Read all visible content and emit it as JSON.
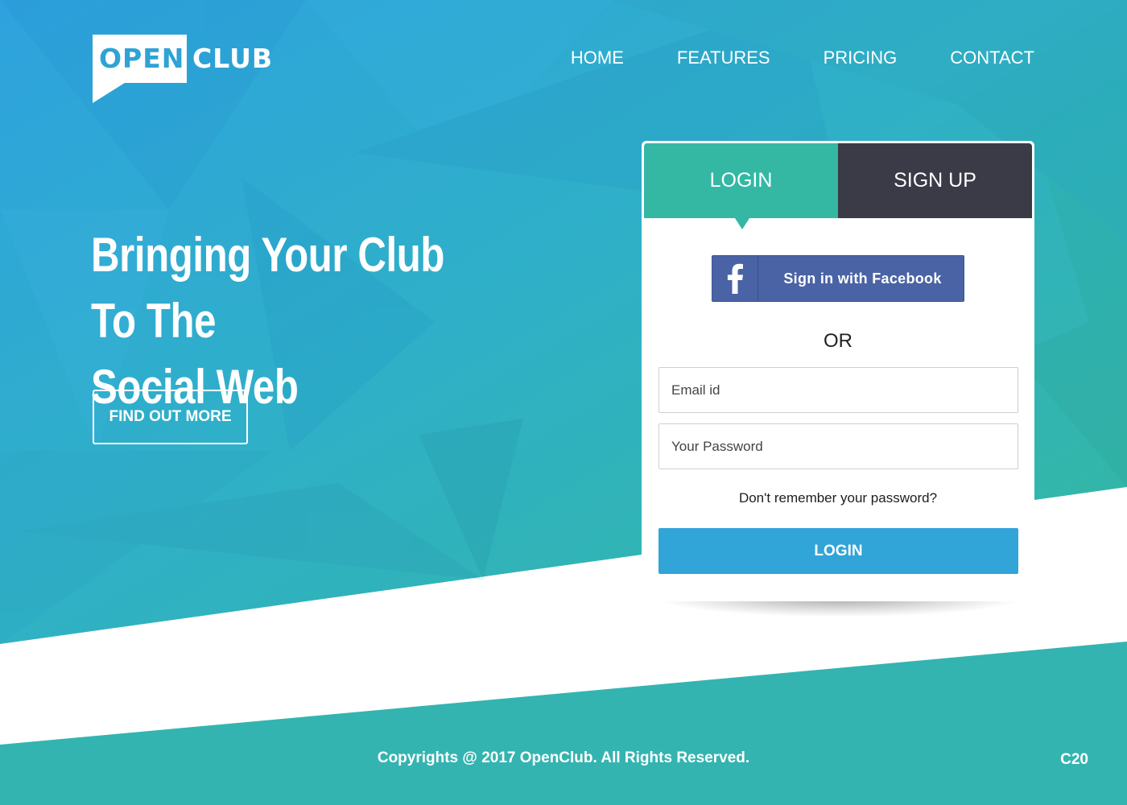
{
  "brand": {
    "logo_open": "OPEN",
    "logo_club": "CLUB"
  },
  "nav": {
    "items": [
      {
        "label": "HOME"
      },
      {
        "label": "FEATURES"
      },
      {
        "label": "PRICING"
      },
      {
        "label": "CONTACT"
      }
    ]
  },
  "hero": {
    "title_line1": "Bringing Your Club To The",
    "title_line2": "Social Web",
    "cta_label": "FIND OUT MORE"
  },
  "auth_card": {
    "tabs": [
      {
        "label": "LOGIN",
        "active": true
      },
      {
        "label": "SIGN UP",
        "active": false
      }
    ],
    "facebook_label": "Sign in with Facebook",
    "or_label": "OR",
    "email_placeholder": "Email id",
    "password_placeholder": "Your Password",
    "forgot_label": "Don't remember your password?",
    "submit_label": "LOGIN"
  },
  "footer": {
    "copyright": "Copyrights @ 2017 OpenClub. All Rights Reserved.",
    "code": "C20"
  },
  "colors": {
    "hero_gradient_start": "#2ea6dc",
    "hero_gradient_end": "#33b5a2",
    "tab_active": "#34b8a4",
    "tab_inactive": "#3b3a47",
    "facebook": "#4a63a5",
    "login_button": "#31a4d8",
    "footer": "#34b4b0"
  },
  "icons": {
    "facebook": "facebook-f-icon"
  }
}
